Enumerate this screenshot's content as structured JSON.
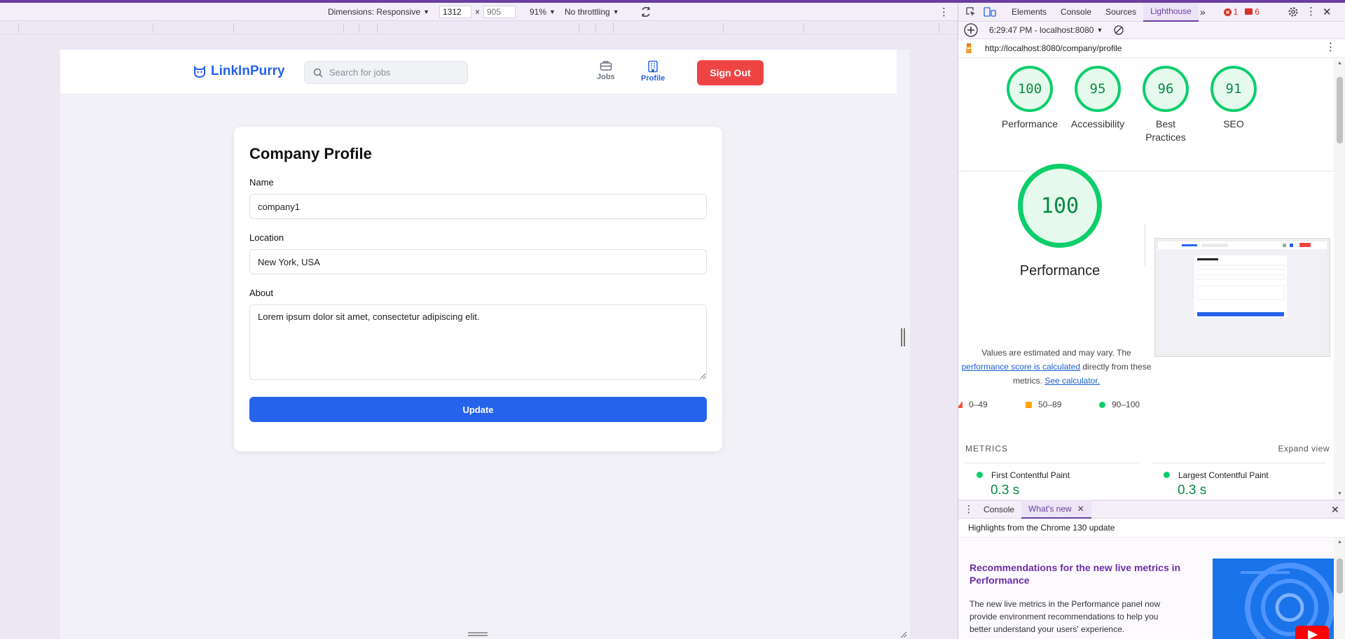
{
  "device_toolbar": {
    "dimensions_label": "Dimensions: Responsive",
    "width": "1312",
    "height_placeholder": "905",
    "times": "×",
    "zoom": "91%",
    "throttling": "No throttling"
  },
  "app": {
    "brand": "LinkInPurry",
    "search_placeholder": "Search for jobs",
    "nav": {
      "jobs": "Jobs",
      "profile": "Profile"
    },
    "sign_out": "Sign Out",
    "colors": {
      "accent": "#2563eb",
      "danger": "#ef4444"
    }
  },
  "profile_form": {
    "title": "Company Profile",
    "name_label": "Name",
    "name_value": "company1",
    "location_label": "Location",
    "location_value": "New York, USA",
    "about_label": "About",
    "about_value": "Lorem ipsum dolor sit amet, consectetur adipiscing elit.",
    "submit": "Update"
  },
  "devtools": {
    "tabs": [
      "Elements",
      "Console",
      "Sources",
      "Lighthouse"
    ],
    "active_tab": "Lighthouse",
    "error_count": "1",
    "issue_count": "6",
    "report_time": "6:29:47 PM - localhost:8080",
    "url": "http://localhost:8080/company/profile",
    "scores": [
      {
        "value": "100",
        "label": "Performance"
      },
      {
        "value": "95",
        "label": "Accessibility"
      },
      {
        "value": "96",
        "label": "Best Practices"
      },
      {
        "value": "91",
        "label": "SEO"
      }
    ],
    "performance": {
      "score": "100",
      "title": "Performance",
      "desc_pre": "Values are estimated and may vary. The",
      "desc_link1": "performance score is calculated",
      "desc_mid": "directly from these metrics.",
      "desc_link2": "See calculator.",
      "legend": [
        "0–49",
        "50–89",
        "90–100"
      ]
    },
    "metrics_header": "METRICS",
    "expand_view": "Expand view",
    "metrics": [
      {
        "name": "First Contentful Paint",
        "value": "0.3 s"
      },
      {
        "name": "Largest Contentful Paint",
        "value": "0.3 s"
      }
    ],
    "score_color": "#0cce6b",
    "drawer": {
      "tabs": [
        "Console",
        "What's new"
      ],
      "active_tab": "What's new",
      "header": "Highlights from the Chrome 130 update",
      "title": "Recommendations for the new live metrics in Performance",
      "text": "The new live metrics in the Performance panel now provide environment recommendations to help you better understand your users' experience."
    }
  }
}
